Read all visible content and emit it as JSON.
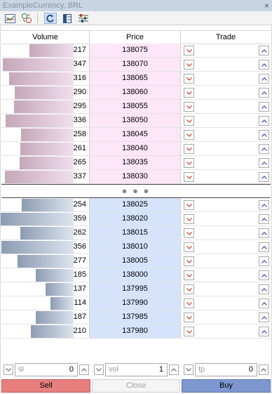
{
  "window": {
    "title": "ExampleCurrency, BRL",
    "close_glyph": "×"
  },
  "toolbar": {
    "buttons": [
      {
        "icon": "chart-icon"
      },
      {
        "icon": "one-click-trading-icon"
      },
      {
        "icon": "auto-center-icon"
      },
      {
        "icon": "columns-icon"
      },
      {
        "icon": "settings-icon"
      }
    ]
  },
  "columns": {
    "volume": "Volume",
    "price": "Price",
    "trade": "Trade"
  },
  "asks": [
    {
      "volume": "217",
      "price": "138075"
    },
    {
      "volume": "347",
      "price": "138070"
    },
    {
      "volume": "316",
      "price": "138065"
    },
    {
      "volume": "290",
      "price": "138060"
    },
    {
      "volume": "295",
      "price": "138055"
    },
    {
      "volume": "336",
      "price": "138050"
    },
    {
      "volume": "258",
      "price": "138045"
    },
    {
      "volume": "261",
      "price": "138040"
    },
    {
      "volume": "265",
      "price": "138035"
    },
    {
      "volume": "337",
      "price": "138030"
    }
  ],
  "spread_indicator": "● ● ●",
  "bids": [
    {
      "volume": "254",
      "price": "138025"
    },
    {
      "volume": "359",
      "price": "138020"
    },
    {
      "volume": "262",
      "price": "138015"
    },
    {
      "volume": "356",
      "price": "138010"
    },
    {
      "volume": "277",
      "price": "138005"
    },
    {
      "volume": "185",
      "price": "138000"
    },
    {
      "volume": "137",
      "price": "137995"
    },
    {
      "volume": "114",
      "price": "137990"
    },
    {
      "volume": "187",
      "price": "137985"
    },
    {
      "volume": "210",
      "price": "137980"
    }
  ],
  "order_fields": {
    "sl": {
      "label": "sl",
      "value": "0"
    },
    "vol": {
      "label": "vol",
      "value": "1"
    },
    "tp": {
      "label": "tp",
      "value": "0"
    }
  },
  "actions": {
    "sell": "Sell",
    "close": "Close",
    "buy": "Buy"
  },
  "colors": {
    "ask_price_bg": "#fde6f7",
    "bid_price_bg": "#d5e4fb",
    "sell_button": "#e77f7f",
    "buy_button": "#7e98cf"
  }
}
